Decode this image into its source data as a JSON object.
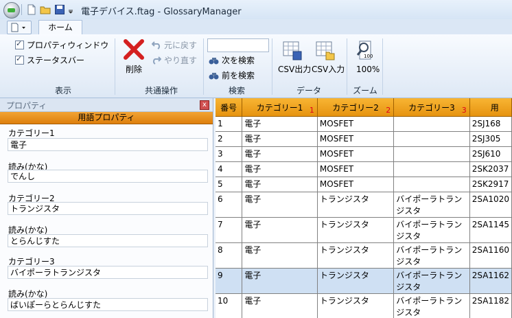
{
  "window": {
    "title": "電子デバイス.ftag - GlossaryManager"
  },
  "ribbon": {
    "active_tab": "ホーム",
    "groups": {
      "display": {
        "label": "表示",
        "options": [
          {
            "label": "プロパティウィンドウ",
            "checked": true
          },
          {
            "label": "ステータスバー",
            "checked": true
          }
        ]
      },
      "common": {
        "label": "共通操作",
        "delete": "削除",
        "undo": "元に戻す",
        "redo": "やり直す"
      },
      "search": {
        "label": "検索",
        "input_value": "",
        "next": "次を検索",
        "prev": "前を検索"
      },
      "data": {
        "label": "データ",
        "csv_out": "CSV出力",
        "csv_in": "CSV入力"
      },
      "zoom": {
        "label": "ズーム",
        "level": "100%",
        "icon_text": "100"
      }
    }
  },
  "properties": {
    "title": "プロパティ",
    "close": "x",
    "section": "用語プロパティ",
    "fields": [
      {
        "label": "カテゴリー1",
        "value": "電子"
      },
      {
        "label": "読み(かな)",
        "value": "でんし"
      },
      {
        "label": "カテゴリー2",
        "value": "トランジスタ"
      },
      {
        "label": "読み(かな)",
        "value": "とらんじすた"
      },
      {
        "label": "カテゴリー3",
        "value": "バイポーラトランジスタ"
      },
      {
        "label": "読み(かな)",
        "value": "ばいぽーらとらんじすた"
      }
    ]
  },
  "grid": {
    "columns": [
      {
        "label": "番号",
        "marker": ""
      },
      {
        "label": "カテゴリー1",
        "marker": "1"
      },
      {
        "label": "カテゴリー2",
        "marker": "2"
      },
      {
        "label": "カテゴリー3",
        "marker": "3"
      },
      {
        "label": "用",
        "marker": ""
      }
    ],
    "selected_row": "9",
    "rows": [
      {
        "no": "1",
        "c1": "電子",
        "c2": "MOSFET",
        "c3": "",
        "term": "2SJ168"
      },
      {
        "no": "2",
        "c1": "電子",
        "c2": "MOSFET",
        "c3": "",
        "term": "2SJ305"
      },
      {
        "no": "3",
        "c1": "電子",
        "c2": "MOSFET",
        "c3": "",
        "term": "2SJ610"
      },
      {
        "no": "4",
        "c1": "電子",
        "c2": "MOSFET",
        "c3": "",
        "term": "2SK2037"
      },
      {
        "no": "5",
        "c1": "電子",
        "c2": "MOSFET",
        "c3": "",
        "term": "2SK2917"
      },
      {
        "no": "6",
        "c1": "電子",
        "c2": "トランジスタ",
        "c3": "バイポーラトランジスタ",
        "term": "2SA1020"
      },
      {
        "no": "7",
        "c1": "電子",
        "c2": "トランジスタ",
        "c3": "バイポーラトランジスタ",
        "term": "2SA1145"
      },
      {
        "no": "8",
        "c1": "電子",
        "c2": "トランジスタ",
        "c3": "バイポーラトランジスタ",
        "term": "2SA1160"
      },
      {
        "no": "9",
        "c1": "電子",
        "c2": "トランジスタ",
        "c3": "バイポーラトランジスタ",
        "term": "2SA1162"
      },
      {
        "no": "10",
        "c1": "電子",
        "c2": "トランジスタ",
        "c3": "バイポーラトランジスタ",
        "term": "2SA1182"
      }
    ]
  }
}
